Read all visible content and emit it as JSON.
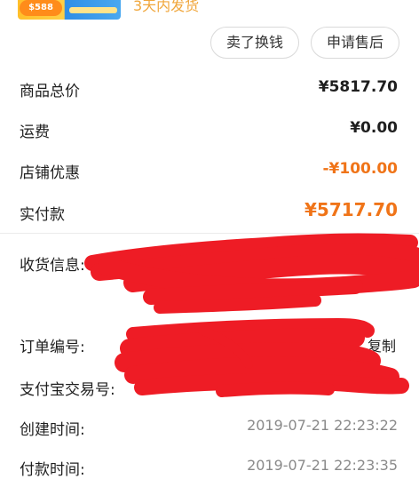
{
  "header": {
    "thumbnail_badge": "$588",
    "delivery_note": "3天内发货"
  },
  "actions": {
    "resell_label": "卖了换钱",
    "after_sale_label": "申请售后"
  },
  "price_summary": {
    "goods_total_label": "商品总价",
    "goods_total_value": "¥5817.70",
    "shipping_label": "运费",
    "shipping_value": "¥0.00",
    "store_discount_label": "店铺优惠",
    "store_discount_value": "-¥100.00",
    "paid_label": "实付款",
    "paid_value": "¥5717.70"
  },
  "order_info": {
    "shipping_info_label": "收货信息:",
    "order_number_label": "订单编号:",
    "copy_label": "复制",
    "alipay_trade_label": "支付宝交易号:",
    "created_time_label": "创建时间:",
    "created_time_value": "2019-07-21 22:23:22",
    "paid_time_label": "付款时间:",
    "paid_time_value": "2019-07-21 22:23:35"
  },
  "colors": {
    "accent_orange": "#f07418",
    "delivery_note": "#f0a63b",
    "redaction_red": "#ee1c25"
  }
}
